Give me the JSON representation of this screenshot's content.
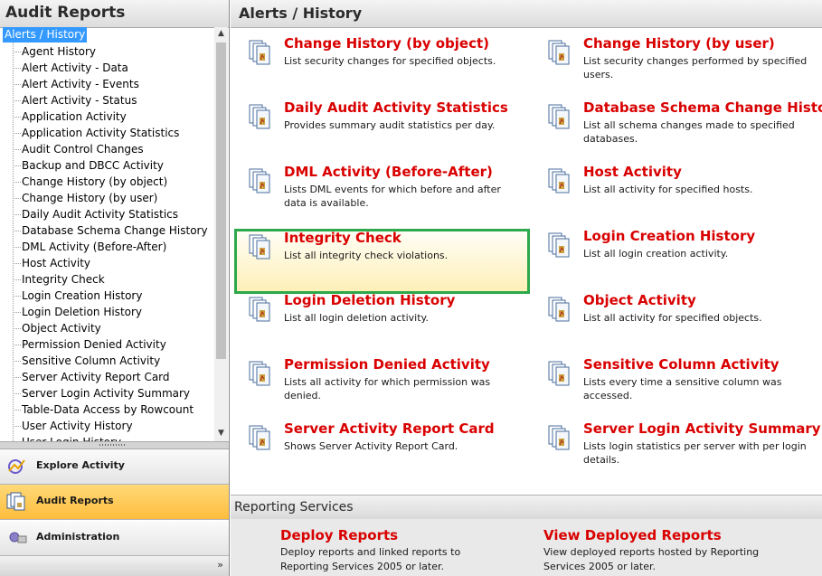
{
  "left": {
    "title": "Audit Reports",
    "tree_root": "Alerts /  History",
    "tree_items": [
      "Agent History",
      "Alert Activity - Data",
      "Alert Activity - Events",
      "Alert Activity - Status",
      "Application Activity",
      "Application Activity Statistics",
      "Audit Control Changes",
      "Backup and DBCC Activity",
      "Change History (by object)",
      "Change History (by user)",
      "Daily Audit Activity Statistics",
      "Database Schema Change History",
      "DML Activity (Before-After)",
      "Host Activity",
      "Integrity Check",
      "Login Creation History",
      "Login Deletion History",
      "Object Activity",
      "Permission Denied Activity",
      "Sensitive Column Activity",
      "Server Activity Report Card",
      "Server Login Activity Summary",
      "Table-Data Access by Rowcount",
      "User Activity History",
      "User Login History"
    ],
    "nav": [
      {
        "label": "Explore Activity",
        "active": false
      },
      {
        "label": "Audit Reports",
        "active": true
      },
      {
        "label": "Administration",
        "active": false
      }
    ],
    "footer_chevron": "»"
  },
  "right": {
    "title": "Alerts /  History",
    "reports": [
      {
        "title": "Change History (by object)",
        "desc": "List security changes for specified objects."
      },
      {
        "title": "Change History (by user)",
        "desc": "List security changes performed by specified users."
      },
      {
        "title": "Daily Audit Activity Statistics",
        "desc": "Provides summary audit statistics per day."
      },
      {
        "title": "Database Schema Change History",
        "desc": "List all schema changes made to specified databases."
      },
      {
        "title": "DML Activity (Before-After)",
        "desc": "Lists DML events for which before and after data is available."
      },
      {
        "title": "Host Activity",
        "desc": "List all activity for specified hosts."
      },
      {
        "title": "Integrity Check",
        "desc": "List all integrity check violations.",
        "highlighted": true
      },
      {
        "title": "Login Creation History",
        "desc": "List all login creation activity."
      },
      {
        "title": "Login Deletion History",
        "desc": "List all login deletion activity."
      },
      {
        "title": "Object Activity",
        "desc": "List all activity for specified objects."
      },
      {
        "title": "Permission Denied Activity",
        "desc": "Lists all activity for which permission was denied."
      },
      {
        "title": "Sensitive Column Activity",
        "desc": "Lists every time a sensitive column was accessed."
      },
      {
        "title": "Server Activity Report Card",
        "desc": "Shows Server Activity Report Card."
      },
      {
        "title": "Server Login Activity Summary",
        "desc": "Lists login statistics per server with per login details."
      }
    ],
    "reporting_services": {
      "title": "Reporting Services",
      "items": [
        {
          "title": "Deploy Reports",
          "desc": "Deploy reports and linked reports to Reporting Services 2005 or later."
        },
        {
          "title": "View Deployed Reports",
          "desc": "View deployed reports hosted by Reporting Services 2005 or later."
        }
      ]
    }
  },
  "icons": {
    "report": "report-stack-icon",
    "explore": "explore-activity-icon",
    "audit": "audit-reports-icon",
    "admin": "administration-icon"
  },
  "colors": {
    "accent_red": "#d90000",
    "selection_blue": "#3399ff",
    "highlight_border": "#2da84a",
    "active_nav": "#ffc850"
  }
}
